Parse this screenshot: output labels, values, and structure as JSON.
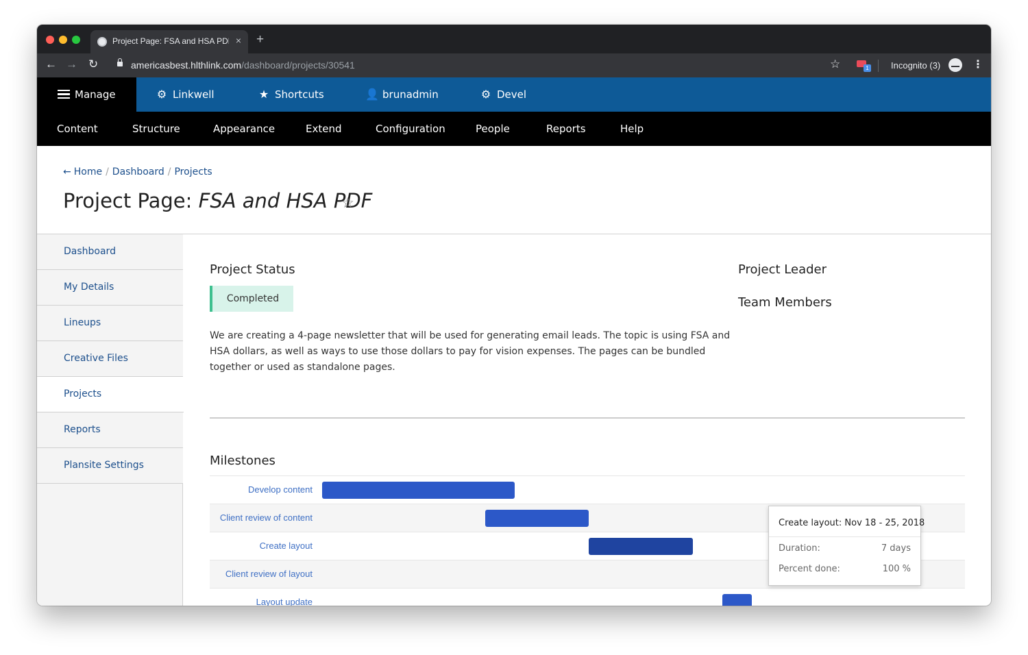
{
  "browser": {
    "tab_title": "Project Page: FSA and HSA PDF",
    "tab_close": "×",
    "new_tab": "+",
    "back": "←",
    "forward": "→",
    "reload": "↻",
    "url_host": "americasbest.hlthlink.com",
    "url_path": "/dashboard/projects/30541",
    "bookmark_star": "☆",
    "ext_badge": "1",
    "incognito": "Incognito (3)",
    "menu": "⋮"
  },
  "toolbar": {
    "manage": "Manage",
    "linkwell": "Linkwell",
    "shortcuts": "Shortcuts",
    "user": "brunadmin",
    "devel": "Devel",
    "gear_glyph": "⚙",
    "star_glyph": "★",
    "user_glyph": "👤"
  },
  "tray": [
    "Content",
    "Structure",
    "Appearance",
    "Extend",
    "Configuration",
    "People",
    "Reports",
    "Help"
  ],
  "breadcrumb": {
    "arrow": "←",
    "items": [
      "Home",
      "Dashboard",
      "Projects"
    ],
    "separator": "/"
  },
  "page": {
    "title_prefix": "Project Page: ",
    "title_italic": "FSA and HSA PDF",
    "favorite_star": "☆"
  },
  "sidebar": {
    "items": [
      "Dashboard",
      "My Details",
      "Lineups",
      "Creative Files",
      "Projects",
      "Reports",
      "Plansite Settings"
    ],
    "active": "Projects"
  },
  "project": {
    "status_heading": "Project Status",
    "status": "Completed",
    "description": "We are creating a 4-page newsletter that will be used for generating email leads. The topic is using FSA and HSA dollars, as well as ways to use those dollars to pay for vision expenses. The pages can be bundled together or used as standalone pages.",
    "leader_heading": "Project Leader",
    "team_heading": "Team Members"
  },
  "milestones": {
    "heading": "Milestones",
    "rows": [
      {
        "label": "Develop content",
        "start_frac": 0.0,
        "end_frac": 0.3
      },
      {
        "label": "Client review of content",
        "start_frac": 0.254,
        "end_frac": 0.415
      },
      {
        "label": "Create layout",
        "start_frac": 0.415,
        "end_frac": 0.577
      },
      {
        "label": "Client review of layout",
        "start_frac": null,
        "end_frac": null
      },
      {
        "label": "Layout update",
        "start_frac": 0.623,
        "end_frac": 0.669
      }
    ],
    "colors": {
      "bar": "#2c58c8",
      "bar_highlight": "#1f44a0",
      "label": "#3e6fc4"
    },
    "tooltip": {
      "title": "Create layout: Nov 18 - 25, 2018",
      "duration_label": "Duration:",
      "duration_value": "7 days",
      "percent_label": "Percent done:",
      "percent_value": "100 %"
    }
  },
  "colors": {
    "toolbar_blue": "#0e5a97",
    "link": "#1c4f8c",
    "status_bg": "#d8f3ea",
    "status_accent": "#3ec08f"
  }
}
